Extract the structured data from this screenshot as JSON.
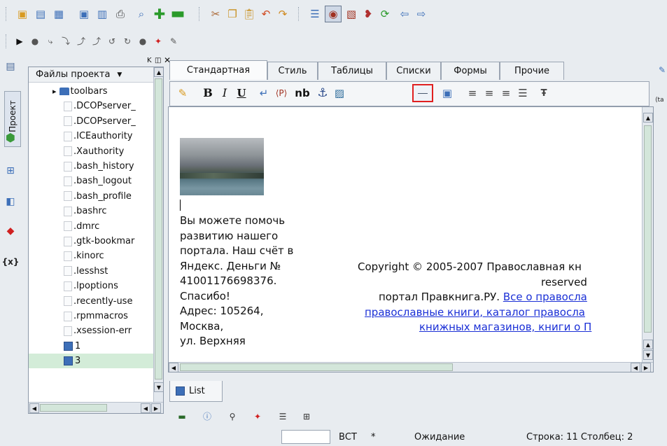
{
  "toolbar1": {
    "icons": [
      "new-file-icon",
      "open-project-icon",
      "open-file-icon",
      "save-icon",
      "save-all-icon",
      "print-icon",
      "preview-icon",
      "add-icon",
      "remove-icon",
      "cut-icon",
      "copy-icon",
      "paste-icon",
      "undo-icon",
      "redo-icon",
      "view-source-icon",
      "view-preview-icon",
      "view-split-icon",
      "spellcheck-icon",
      "reload-icon",
      "back-icon",
      "forward-icon"
    ]
  },
  "toolbar2": {
    "icons": [
      "run-icon",
      "breakpoint-icon",
      "step-into-icon",
      "step-over-icon",
      "step-out-icon",
      "step-out2-icon",
      "step-back-icon",
      "return-icon",
      "stop-icon",
      "debug-pin-icon",
      "tool-icon"
    ]
  },
  "sidebar": {
    "vertical_tab_label": "Проект",
    "project_files_label": "Файлы проекта",
    "items": [
      {
        "label": "toolbars",
        "type": "folder"
      },
      {
        "label": ".DCOPserver_",
        "type": "file"
      },
      {
        "label": ".DCOPserver_",
        "type": "file"
      },
      {
        "label": ".ICEauthority",
        "type": "file"
      },
      {
        "label": ".Xauthority",
        "type": "file"
      },
      {
        "label": ".bash_history",
        "type": "file"
      },
      {
        "label": ".bash_logout",
        "type": "file"
      },
      {
        "label": ".bash_profile",
        "type": "file"
      },
      {
        "label": ".bashrc",
        "type": "file"
      },
      {
        "label": ".dmrc",
        "type": "file"
      },
      {
        "label": ".gtk-bookmar",
        "type": "file"
      },
      {
        "label": ".kinorc",
        "type": "file"
      },
      {
        "label": ".lesshst",
        "type": "file"
      },
      {
        "label": ".lpoptions",
        "type": "file"
      },
      {
        "label": ".recently-use",
        "type": "file"
      },
      {
        "label": ".rpmmacros",
        "type": "file"
      },
      {
        "label": ".xsession-err",
        "type": "file"
      },
      {
        "label": "1",
        "type": "doc"
      },
      {
        "label": "3",
        "type": "doc"
      }
    ]
  },
  "editor": {
    "tabs": [
      {
        "label": "Стандартная",
        "active": true
      },
      {
        "label": "Стиль",
        "active": false
      },
      {
        "label": "Таблицы",
        "active": false
      },
      {
        "label": "Списки",
        "active": false
      },
      {
        "label": "Формы",
        "active": false
      },
      {
        "label": "Прочие",
        "active": false
      }
    ],
    "format_buttons": {
      "bold": "B",
      "italic": "I",
      "underline": "U",
      "paragraph": "⟨P⟩",
      "nbsp": "nb"
    },
    "content": {
      "left_text": [
        "Вы можете помочь",
        "развитию нашего",
        "портала. Наш счёт в",
        "Яндекс. Деньги №",
        "41001176698376.",
        "Спасибо!",
        "Адрес: 105264,",
        "Москва,",
        "ул. Верхняя"
      ],
      "right_copyright": "Copyright © 2005-2007 Православная кн",
      "right_reserved": "reserved",
      "right_portal_prefix": "портал Правкнига.РУ. ",
      "right_link1": "Все о правосла",
      "right_link2": "православные книги, каталог правосла",
      "right_link3": "книжных магазинов, книги о П"
    },
    "bottom_tab_label": "List"
  },
  "statusbar": {
    "mode": "ВСТ",
    "modified": "*",
    "state": "Ожидание",
    "position": "Строка: 11 Столбец: 2"
  }
}
